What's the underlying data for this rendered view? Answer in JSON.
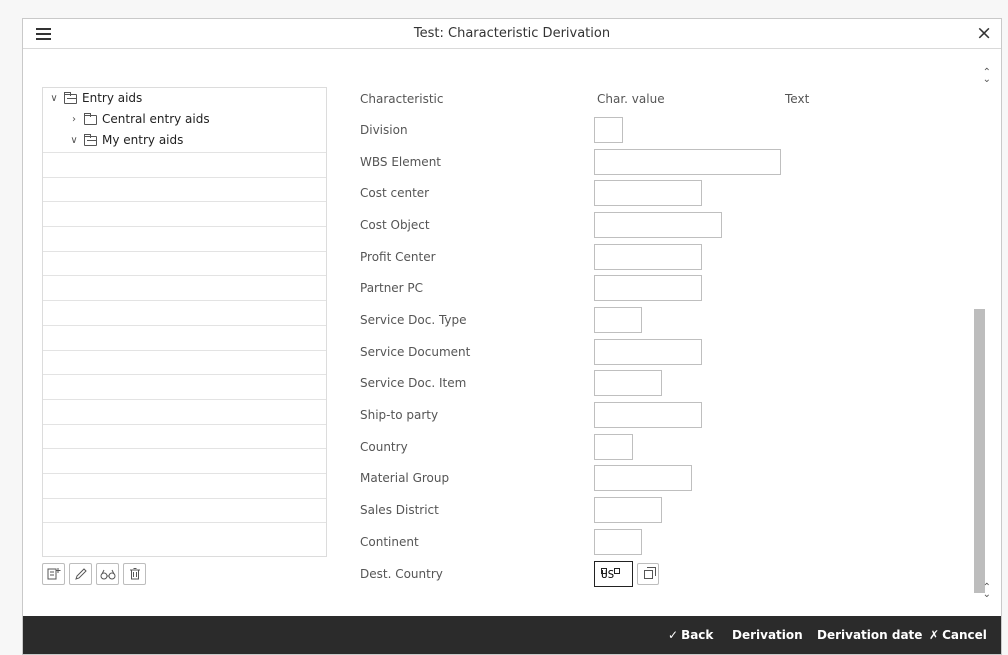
{
  "window": {
    "title": "Test: Characteristic Derivation",
    "menu_icon": "hamburger-menu-icon",
    "close_icon": "close-icon",
    "close_glyph": "×"
  },
  "tree": {
    "root": "Entry aids",
    "children": [
      "Central entry aids",
      "My entry aids"
    ],
    "toolbar_icons": [
      "create-entry-aid-icon",
      "edit-pencil-icon",
      "display-glasses-icon",
      "delete-trash-icon"
    ]
  },
  "table": {
    "headers": {
      "characteristic": "Characteristic",
      "char_value": "Char. value",
      "text": "Text"
    },
    "rows": [
      {
        "label": "Division",
        "value": ""
      },
      {
        "label": "WBS Element",
        "value": ""
      },
      {
        "label": "Cost center",
        "value": ""
      },
      {
        "label": "Cost Object",
        "value": ""
      },
      {
        "label": "Profit Center",
        "value": ""
      },
      {
        "label": "Partner PC",
        "value": ""
      },
      {
        "label": "Service Doc. Type",
        "value": ""
      },
      {
        "label": "Service Document",
        "value": ""
      },
      {
        "label": "Service Doc. Item",
        "value": ""
      },
      {
        "label": "Ship-to party",
        "value": ""
      },
      {
        "label": "Country",
        "value": ""
      },
      {
        "label": "Material Group",
        "value": ""
      },
      {
        "label": "Sales District",
        "value": ""
      },
      {
        "label": "Continent",
        "value": ""
      },
      {
        "label": "Dest. Country",
        "value": "US"
      }
    ]
  },
  "footer": {
    "back": "Back",
    "derivation": "Derivation",
    "derivation_date": "Derivation date",
    "cancel": "Cancel",
    "back_icon": "check-icon",
    "cancel_icon": "cancel-x-icon"
  },
  "colors": {
    "footer_bg": "#2b2b2b",
    "scrollbar": "#bdbdbd"
  }
}
